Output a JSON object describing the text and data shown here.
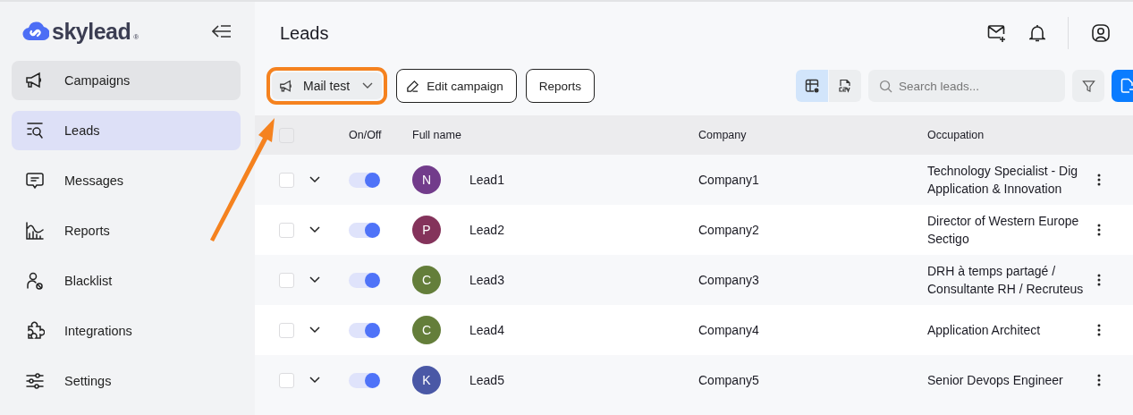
{
  "logo": {
    "name": "skylead",
    "mark": "®"
  },
  "sidebar": {
    "items": [
      {
        "label": "Campaigns",
        "selected": false,
        "hovered": true
      },
      {
        "label": "Leads",
        "selected": true,
        "hovered": false
      },
      {
        "label": "Messages",
        "selected": false,
        "hovered": false
      },
      {
        "label": "Reports",
        "selected": false,
        "hovered": false
      },
      {
        "label": "Blacklist",
        "selected": false,
        "hovered": false
      },
      {
        "label": "Integrations",
        "selected": false,
        "hovered": false
      },
      {
        "label": "Settings",
        "selected": false,
        "hovered": false
      }
    ]
  },
  "page_title": "Leads",
  "toolbar": {
    "campaign_select": {
      "value": "Mail test",
      "highlighted": true
    },
    "buttons": [
      "Edit campaign",
      "Reports"
    ],
    "views": [
      {
        "kind": "table",
        "selected": true
      },
      {
        "kind": "csv",
        "selected": false
      }
    ],
    "search": {
      "placeholder": "Search leads..."
    }
  },
  "pointer_arrow": true,
  "table": {
    "columns": [
      "On/Off",
      "Full name",
      "Company",
      "Occupation"
    ],
    "header_checked": false,
    "rows": [
      {
        "checked": false,
        "on": true,
        "initial": "N",
        "color": "#723c8b",
        "name": "Lead1",
        "company": "Company1",
        "occupation": [
          "Technology Specialist - Dig",
          "Application & Innovation"
        ]
      },
      {
        "checked": false,
        "on": true,
        "initial": "P",
        "color": "#84335b",
        "name": "Lead2",
        "company": "Company2",
        "occupation": [
          "Director of Western Europe",
          "Sectigo"
        ]
      },
      {
        "checked": false,
        "on": true,
        "initial": "C",
        "color": "#647e3a",
        "name": "Lead3",
        "company": "Company3",
        "occupation": [
          "DRH à temps partagé /",
          "Consultante RH / Recruteus"
        ]
      },
      {
        "checked": false,
        "on": true,
        "initial": "C",
        "color": "#647e3a",
        "name": "Lead4",
        "company": "Company4",
        "occupation": [
          "Application Architect"
        ]
      },
      {
        "checked": false,
        "on": true,
        "initial": "K",
        "color": "#4a58a6",
        "name": "Lead5",
        "company": "Company5",
        "occupation": [
          "Senior Devops Engineer"
        ]
      }
    ]
  }
}
